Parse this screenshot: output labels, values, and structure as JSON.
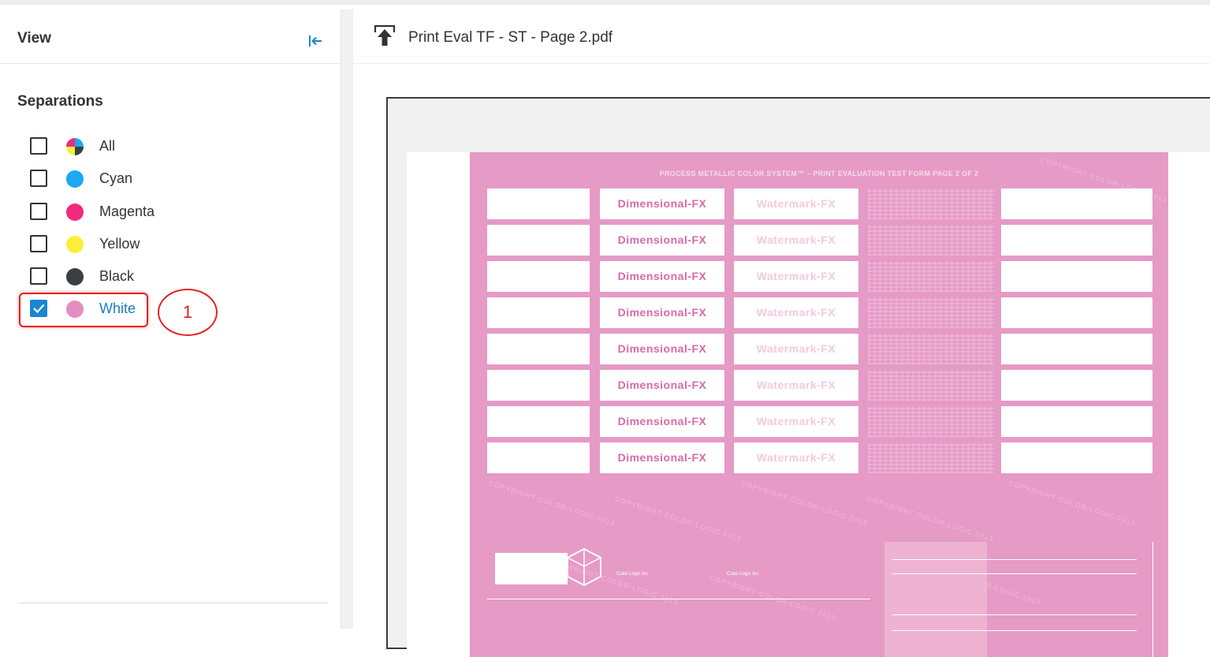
{
  "panel": {
    "title": "View",
    "separations_title": "Separations",
    "separations": [
      {
        "label": "All",
        "checked": false,
        "color": "multi"
      },
      {
        "label": "Cyan",
        "checked": false,
        "color": "#1ea7f2"
      },
      {
        "label": "Magenta",
        "checked": false,
        "color": "#f02a7e"
      },
      {
        "label": "Yellow",
        "checked": false,
        "color": "#fbee3a"
      },
      {
        "label": "Black",
        "checked": false,
        "color": "#3b3f42"
      },
      {
        "label": "White",
        "checked": true,
        "color": "#e58cc0"
      }
    ]
  },
  "annotation": {
    "callout_number": "1",
    "color": "#e32222"
  },
  "viewer": {
    "filename": "Print Eval TF - ST - Page 2.pdf",
    "sheet": {
      "title": "PROCESS METALLIC COLOR SYSTEM™ – PRINT EVALUATION TEST FORM     PAGE 2 OF 2",
      "row_labels_dimensional": [
        "Dimensional-FX",
        "Dimensional-FX",
        "Dimensional-FX",
        "Dimensional-FX",
        "Dimensional-FX",
        "Dimensional-FX",
        "Dimensional-FX",
        "Dimensional-FX"
      ],
      "row_labels_watermark": [
        "Watermark-FX",
        "Watermark-FX",
        "Watermark-FX",
        "Watermark-FX",
        "Watermark-FX",
        "Watermark-FX",
        "Watermark-FX",
        "Watermark-FX"
      ],
      "watermark_text": "COPYRIGHT COLOR-LOGIC 2013",
      "footer_left": "Color-Logic Inc",
      "footer_mid": "Color-Logic Inc",
      "background_color": "#e69ac6"
    }
  }
}
